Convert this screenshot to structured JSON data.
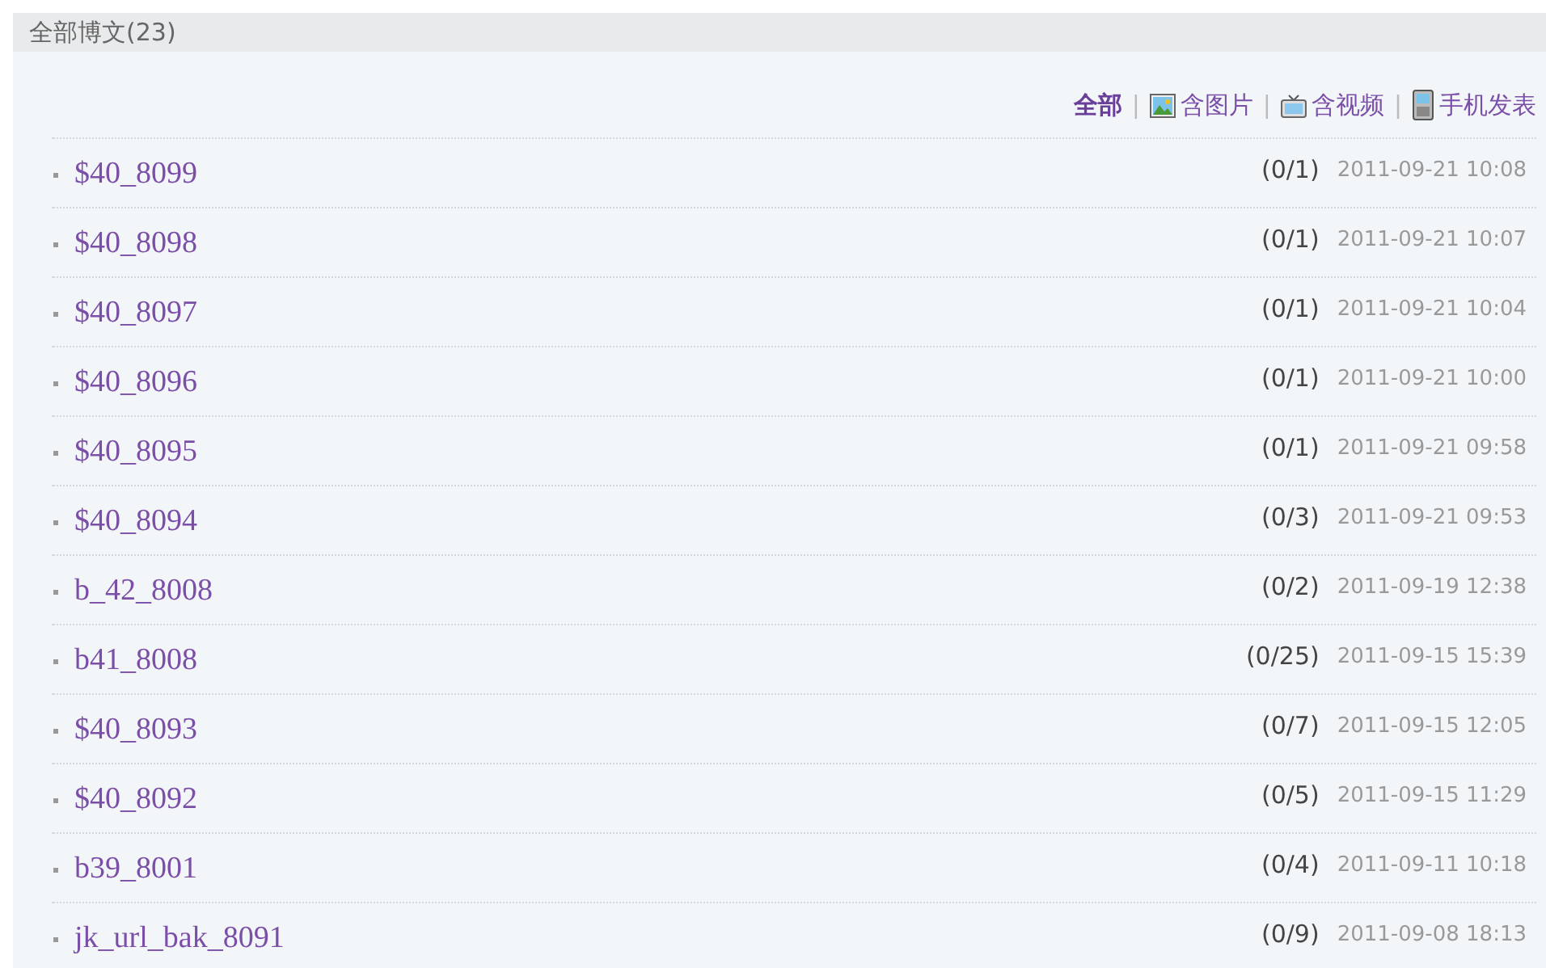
{
  "header": {
    "title": "全部博文(23)"
  },
  "filters": [
    {
      "label": "全部",
      "kind": "all",
      "selected": true
    },
    {
      "separator": "|",
      "label": "含图片",
      "kind": "picture",
      "selected": false
    },
    {
      "separator": "|",
      "label": "含视频",
      "kind": "video",
      "selected": false
    },
    {
      "separator": "|",
      "label": "手机发表",
      "kind": "mobile",
      "selected": false
    }
  ],
  "posts": [
    {
      "title": "$40_8099",
      "comments": "(0/1)",
      "date": "2011-09-21 10:08"
    },
    {
      "title": "$40_8098",
      "comments": "(0/1)",
      "date": "2011-09-21 10:07"
    },
    {
      "title": "$40_8097",
      "comments": "(0/1)",
      "date": "2011-09-21 10:04"
    },
    {
      "title": "$40_8096",
      "comments": "(0/1)",
      "date": "2011-09-21 10:00"
    },
    {
      "title": "$40_8095",
      "comments": "(0/1)",
      "date": "2011-09-21 09:58"
    },
    {
      "title": "$40_8094",
      "comments": "(0/3)",
      "date": "2011-09-21 09:53"
    },
    {
      "title": "b_42_8008",
      "comments": "(0/2)",
      "date": "2011-09-19 12:38"
    },
    {
      "title": "b41_8008",
      "comments": "(0/25)",
      "date": "2011-09-15 15:39"
    },
    {
      "title": "$40_8093",
      "comments": "(0/7)",
      "date": "2011-09-15 12:05"
    },
    {
      "title": "$40_8092",
      "comments": "(0/5)",
      "date": "2011-09-15 11:29"
    },
    {
      "title": "b39_8001",
      "comments": "(0/4)",
      "date": "2011-09-11 10:18"
    },
    {
      "title": "jk_url_bak_8091",
      "comments": "(0/9)",
      "date": "2011-09-08 18:13"
    }
  ]
}
